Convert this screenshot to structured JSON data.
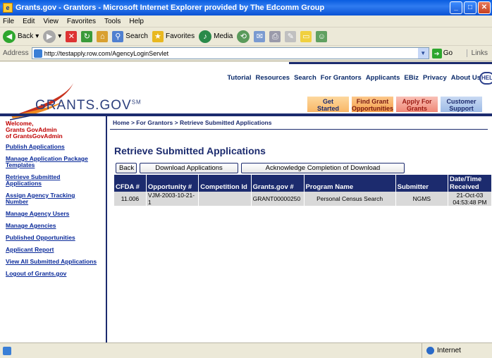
{
  "window": {
    "title": "Grants.gov - Grantors - Microsoft Internet Explorer provided by The Edcomm Group"
  },
  "menu": [
    "File",
    "Edit",
    "View",
    "Favorites",
    "Tools",
    "Help"
  ],
  "toolbar": {
    "back": "Back",
    "search": "Search",
    "favorites": "Favorites",
    "media": "Media"
  },
  "address": {
    "label": "Address",
    "url": "http://testapply.row.com/AgencyLoginServlet",
    "go": "Go",
    "links": "Links"
  },
  "status": {
    "zone": "Internet"
  },
  "page": {
    "topnav": [
      "Tutorial",
      "Resources",
      "Search",
      "For Grantors",
      "Applicants",
      "EBiz",
      "Privacy",
      "About Us"
    ],
    "help": "HEL",
    "logo": "GRANTS.GOV",
    "logo_mark": "SM",
    "tabs": [
      {
        "line1": "Get",
        "line2": "Started"
      },
      {
        "line1": "Find Grant",
        "line2": "Opportunities"
      },
      {
        "line1": "Apply For",
        "line2": "Grants"
      },
      {
        "line1": "Customer",
        "line2": "Support"
      }
    ],
    "welcome": [
      "Welcome,",
      "Grants GovAdmin",
      "of GrantsGovAdmin"
    ],
    "sidebar": [
      "Publish Applications",
      "Manage Application Package Templates",
      "Retrieve Submitted Applications",
      "Assign Agency Tracking Number",
      "Manage Agency Users",
      "Manage Agencies",
      "Published Opportunities",
      "Applicant Report",
      "View All Submitted Applications",
      "Logout of Grants.gov"
    ],
    "breadcrumb": "Home > For Grantors > Retrieve Submitted Applications",
    "title": "Retrieve Submitted Applications",
    "buttons": {
      "back": "Back",
      "download": "Download Applications",
      "ack": "Acknowledge Completion of Download"
    },
    "table": {
      "headers": [
        "CFDA #",
        "Opportunity #",
        "Competition Id",
        "Grants.gov #",
        "Program Name",
        "Submitter",
        "Date/Time Received"
      ],
      "rows": [
        [
          "11.006",
          "VJM-2003-10-21-1",
          "",
          "GRANT00000250",
          "Personal Census Search",
          "NGMS",
          "21-Oct-03 04:53:48 PM"
        ]
      ]
    }
  }
}
